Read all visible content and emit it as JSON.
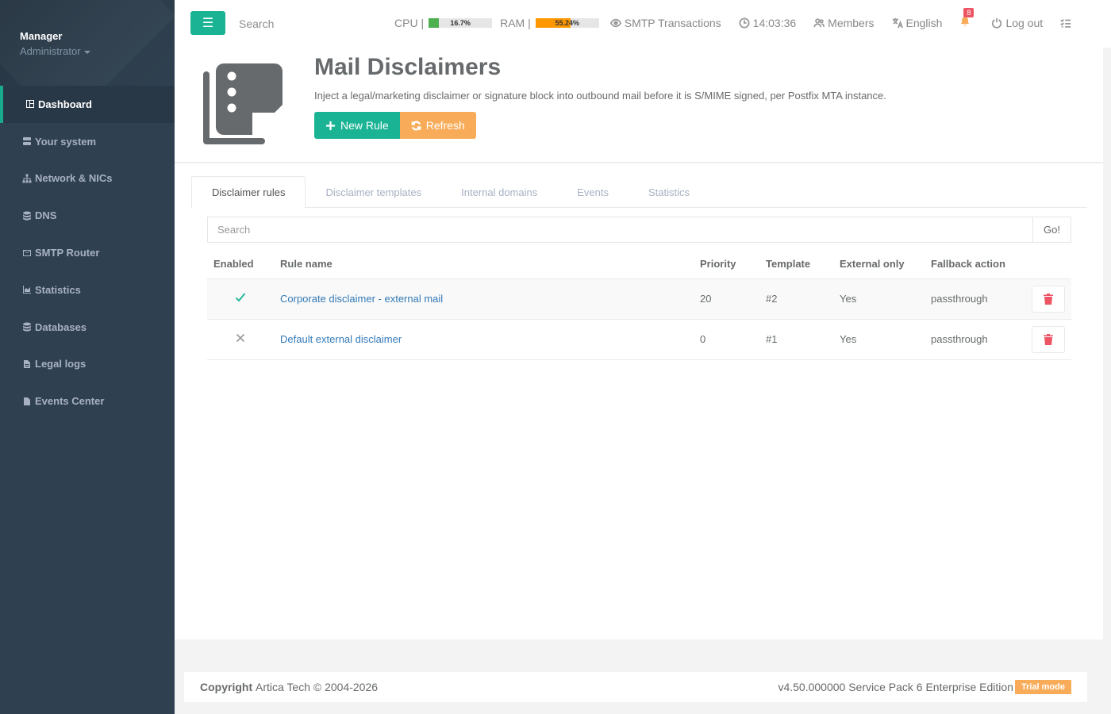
{
  "profile": {
    "name": "Manager",
    "role": "Administrator"
  },
  "sidebar": {
    "items": [
      {
        "label": "Dashboard",
        "icon": "dashboard-icon",
        "active": true
      },
      {
        "label": "Your system",
        "icon": "server-icon"
      },
      {
        "label": "Network & NICs",
        "icon": "sitemap-icon"
      },
      {
        "label": "DNS",
        "icon": "database-icon"
      },
      {
        "label": "SMTP Router",
        "icon": "envelope-icon"
      },
      {
        "label": "Statistics",
        "icon": "area-chart-icon"
      },
      {
        "label": "Databases",
        "icon": "database-icon"
      },
      {
        "label": "Legal logs",
        "icon": "file-text-icon"
      },
      {
        "label": "Events Center",
        "icon": "file-icon"
      }
    ]
  },
  "topbar": {
    "search_placeholder": "Search",
    "cpu_label": "CPU",
    "cpu_value": "16.7%",
    "cpu_fraction": 0.167,
    "ram_label": "RAM",
    "ram_value": "55.24%",
    "ram_fraction": 0.5524,
    "smtp_label": "SMTP Transactions",
    "clock": "14:03:36",
    "members_label": "Members",
    "language_label": "English",
    "notifications_count": "8",
    "logout_label": "Log out"
  },
  "header": {
    "title": "Mail Disclaimers",
    "subtitle": "Inject a legal/marketing disclaimer or signature block into outbound mail before it is S/MIME signed, per Postfix MTA instance.",
    "new_rule_label": "New Rule",
    "refresh_label": "Refresh"
  },
  "tabs": [
    {
      "label": "Disclaimer rules",
      "active": true
    },
    {
      "label": "Disclaimer templates"
    },
    {
      "label": "Internal domains"
    },
    {
      "label": "Events"
    },
    {
      "label": "Statistics"
    }
  ],
  "search": {
    "placeholder": "Search",
    "go_label": "Go!"
  },
  "table": {
    "columns": [
      "Enabled",
      "Rule name",
      "Priority",
      "Template",
      "External only",
      "Fallback action"
    ],
    "rows": [
      {
        "enabled": true,
        "name": "Corporate disclaimer - external mail",
        "priority": "20",
        "template": "#2",
        "external_only": "Yes",
        "fallback": "passthrough"
      },
      {
        "enabled": false,
        "name": "Default external disclaimer",
        "priority": "0",
        "template": "#1",
        "external_only": "Yes",
        "fallback": "passthrough"
      }
    ]
  },
  "footer": {
    "copyright_bold": "Copyright",
    "copyright_text": "Artica Tech © 2004-2026",
    "version": "v4.50.000000 Service Pack 6 Enterprise Edition",
    "trial_label": "Trial mode"
  },
  "colors": {
    "accent": "#1ab394",
    "warning": "#f8ac59",
    "danger": "#ed5565",
    "sidebar": "#2f4050",
    "cpu_bar": "#4caf50",
    "ram_bar": "#ff9800"
  }
}
